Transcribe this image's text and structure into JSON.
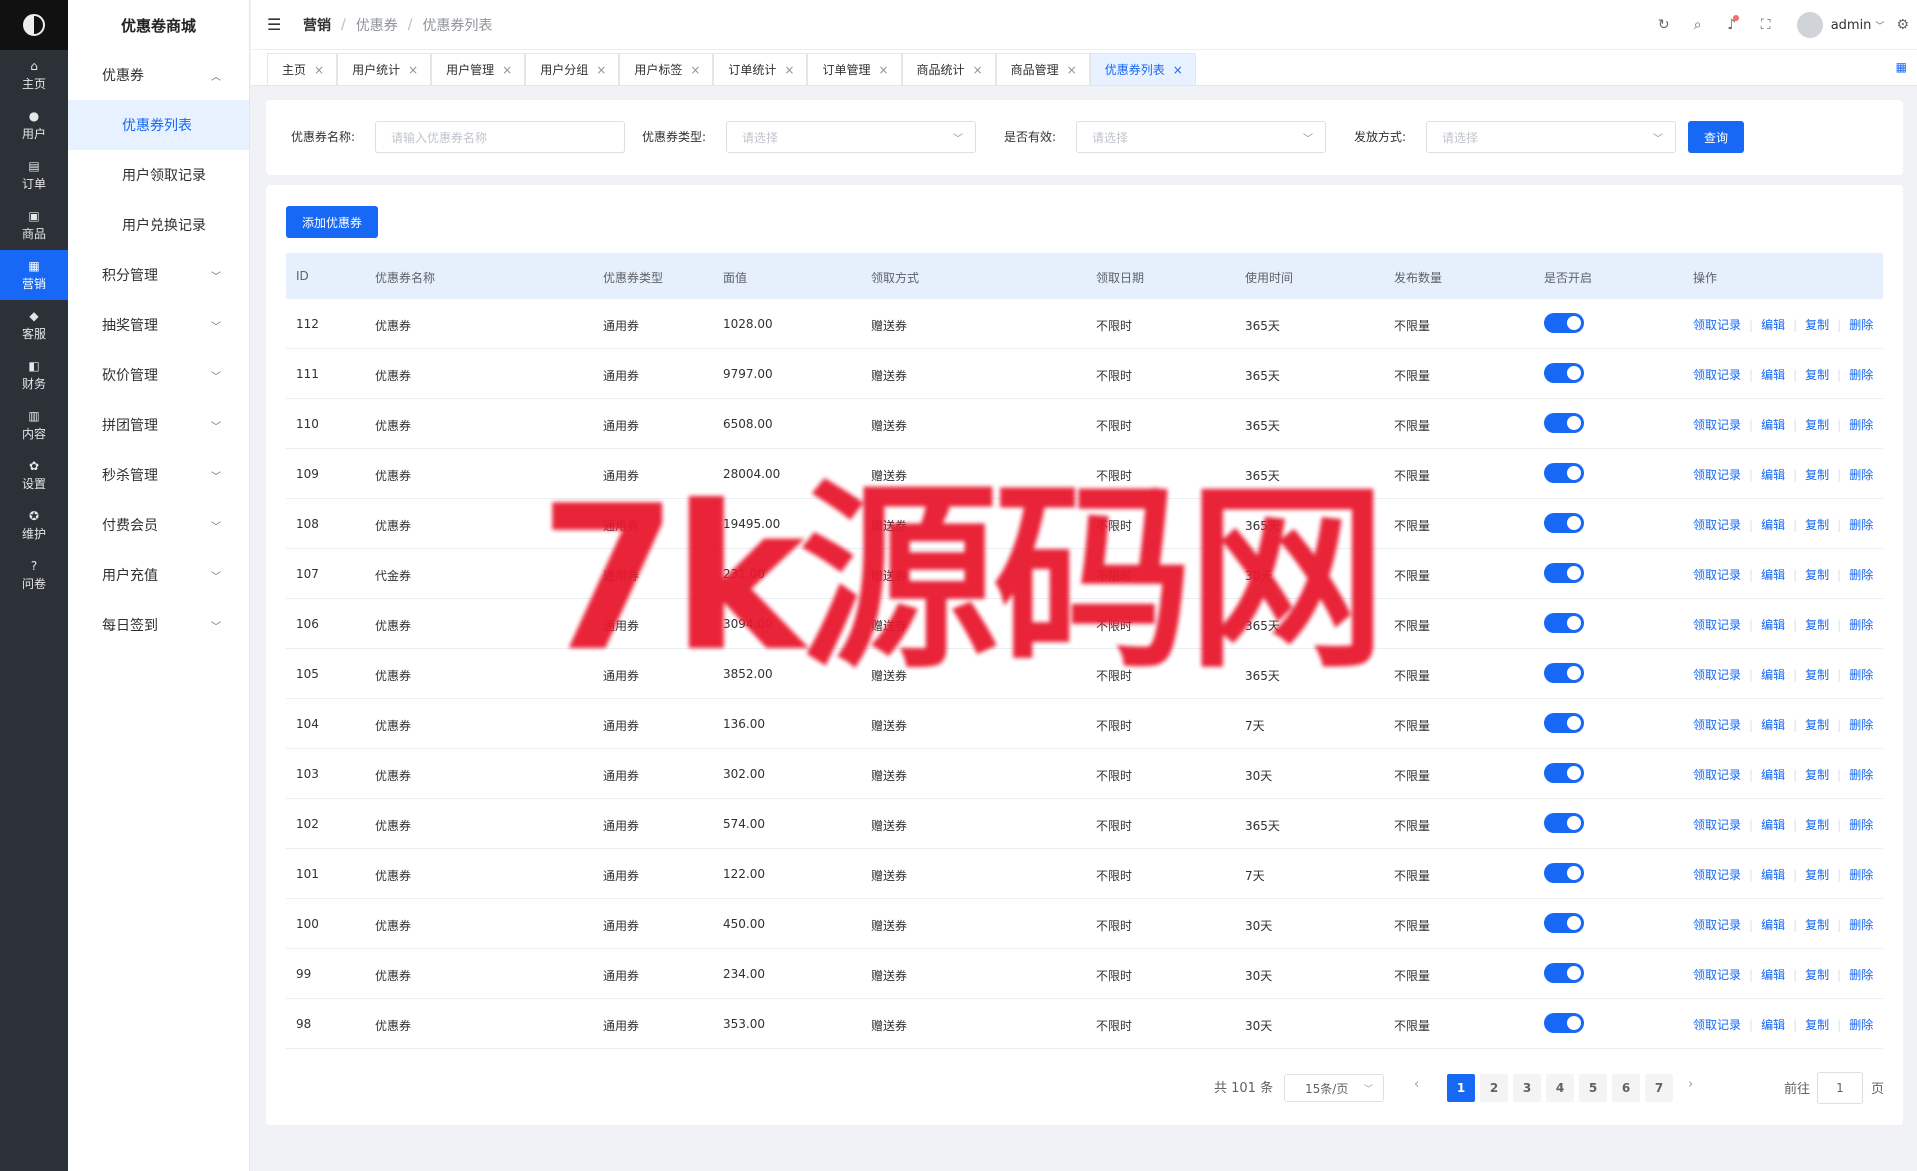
{
  "app": {
    "brand_title": "优惠卷商城"
  },
  "rail": [
    {
      "icon": "home-icon",
      "glyph": "⌂",
      "label": "主页"
    },
    {
      "icon": "user-icon",
      "glyph": "●",
      "label": "用户"
    },
    {
      "icon": "order-icon",
      "glyph": "▤",
      "label": "订单"
    },
    {
      "icon": "goods-icon",
      "glyph": "▣",
      "label": "商品"
    },
    {
      "icon": "marketing-icon",
      "glyph": "▦",
      "label": "营销",
      "active": true
    },
    {
      "icon": "service-icon",
      "glyph": "◆",
      "label": "客服"
    },
    {
      "icon": "finance-icon",
      "glyph": "◧",
      "label": "财务"
    },
    {
      "icon": "content-icon",
      "glyph": "▥",
      "label": "内容"
    },
    {
      "icon": "settings-icon",
      "glyph": "✿",
      "label": "设置"
    },
    {
      "icon": "maintain-icon",
      "glyph": "✪",
      "label": "维护"
    },
    {
      "icon": "question-icon",
      "glyph": "?",
      "label": "问卷"
    }
  ],
  "submenu": {
    "coupon_group": "优惠券",
    "coupon_items": [
      "优惠券列表",
      "用户领取记录",
      "用户兑换记录"
    ],
    "groups": [
      "积分管理",
      "抽奖管理",
      "砍价管理",
      "拼团管理",
      "秒杀管理",
      "付费会员",
      "用户充值",
      "每日签到"
    ]
  },
  "header": {
    "breadcrumb": [
      "营销",
      "优惠券",
      "优惠券列表"
    ],
    "username": "admin"
  },
  "tabs": [
    "主页",
    "用户统计",
    "用户管理",
    "用户分组",
    "用户标签",
    "订单统计",
    "订单管理",
    "商品统计",
    "商品管理",
    "优惠券列表"
  ],
  "filter": {
    "name_label": "优惠券名称:",
    "name_placeholder": "请输入优惠券名称",
    "type_label": "优惠券类型:",
    "type_placeholder": "请选择",
    "valid_label": "是否有效:",
    "valid_placeholder": "请选择",
    "issue_label": "发放方式:",
    "issue_placeholder": "请选择",
    "query_button": "查询"
  },
  "table": {
    "add_button": "添加优惠券",
    "columns": [
      "ID",
      "优惠券名称",
      "优惠券类型",
      "面值",
      "领取方式",
      "领取日期",
      "使用时间",
      "发布数量",
      "是否开启",
      "操作"
    ],
    "actions": [
      "领取记录",
      "编辑",
      "复制",
      "删除"
    ],
    "rows": [
      [
        "112",
        "优惠券",
        "通用券",
        "1028.00",
        "赠送券",
        "不限时",
        "365天",
        "不限量"
      ],
      [
        "111",
        "优惠券",
        "通用券",
        "9797.00",
        "赠送券",
        "不限时",
        "365天",
        "不限量"
      ],
      [
        "110",
        "优惠券",
        "通用券",
        "6508.00",
        "赠送券",
        "不限时",
        "365天",
        "不限量"
      ],
      [
        "109",
        "优惠券",
        "通用券",
        "28004.00",
        "赠送券",
        "不限时",
        "365天",
        "不限量"
      ],
      [
        "108",
        "优惠券",
        "通用券",
        "19495.00",
        "赠送券",
        "不限时",
        "365天",
        "不限量"
      ],
      [
        "107",
        "代金券",
        "通用券",
        "231.00",
        "赠送券",
        "不限时",
        "30天",
        "不限量"
      ],
      [
        "106",
        "优惠券",
        "通用券",
        "3094.00",
        "赠送券",
        "不限时",
        "365天",
        "不限量"
      ],
      [
        "105",
        "优惠券",
        "通用券",
        "3852.00",
        "赠送券",
        "不限时",
        "365天",
        "不限量"
      ],
      [
        "104",
        "优惠券",
        "通用券",
        "136.00",
        "赠送券",
        "不限时",
        "7天",
        "不限量"
      ],
      [
        "103",
        "优惠券",
        "通用券",
        "302.00",
        "赠送券",
        "不限时",
        "30天",
        "不限量"
      ],
      [
        "102",
        "优惠券",
        "通用券",
        "574.00",
        "赠送券",
        "不限时",
        "365天",
        "不限量"
      ],
      [
        "101",
        "优惠券",
        "通用券",
        "122.00",
        "赠送券",
        "不限时",
        "7天",
        "不限量"
      ],
      [
        "100",
        "优惠券",
        "通用券",
        "450.00",
        "赠送券",
        "不限时",
        "30天",
        "不限量"
      ],
      [
        "99",
        "优惠券",
        "通用券",
        "234.00",
        "赠送券",
        "不限时",
        "30天",
        "不限量"
      ],
      [
        "98",
        "优惠券",
        "通用券",
        "353.00",
        "赠送券",
        "不限时",
        "30天",
        "不限量"
      ]
    ],
    "enabled": [
      true,
      true,
      true,
      true,
      true,
      true,
      true,
      true,
      true,
      true,
      true,
      true,
      true,
      true,
      true
    ]
  },
  "pagination": {
    "total_text": "共 101 条",
    "page_size": "15条/页",
    "pages": [
      "1",
      "2",
      "3",
      "4",
      "5",
      "6",
      "7"
    ],
    "current_page": "1",
    "goto_label": "前往",
    "goto_value": "1",
    "goto_suffix": "页"
  },
  "watermark": {
    "text": "7k源码网"
  },
  "colors": {
    "accent": "#1668f5",
    "rail_bg": "#2b3137",
    "watermark": "#e8182e",
    "table_header_bg": "#e6f0fd"
  }
}
